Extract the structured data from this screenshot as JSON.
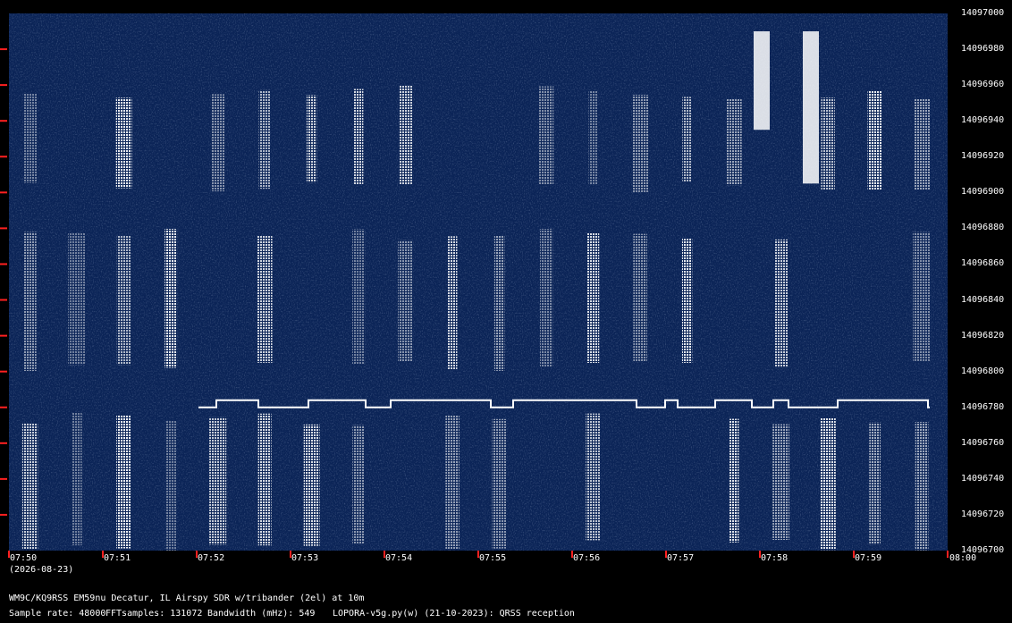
{
  "chart_data": {
    "type": "heatmap",
    "colors": {
      "background": "#0b2457",
      "signal": "#ffffff",
      "tick": "#ff2020",
      "text": "#ffffff"
    },
    "y_axis": {
      "min": 14096700,
      "max": 14097000,
      "ticks": [
        "14097000",
        "14096980",
        "14096960",
        "14096940",
        "14096920",
        "14096900",
        "14096880",
        "14096860",
        "14096840",
        "14096820",
        "14096800",
        "14096780",
        "14096760",
        "14096740",
        "14096720",
        "14096700"
      ]
    },
    "x_axis": {
      "ticks": [
        "07:50",
        "07:51",
        "07:52",
        "07:53",
        "07:54",
        "07:55",
        "07:56",
        "07:57",
        "07:58",
        "07:59",
        "08:00"
      ],
      "date_label": "(2026-08-23)"
    },
    "callsign_trace": {
      "name": "",
      "comment": "",
      "base_hz": 14096780,
      "high_hz": 14096784
    }
  },
  "footer": {
    "station": "WM9C/KQ9RSS EM59nu Decatur, IL  Airspy SDR w/tribander (2el) at 10m",
    "sample_rate": "Sample rate: 48000",
    "fft_samples": "FFTsamples: 131072",
    "bandwidth": "Bandwidth (mHz): 549",
    "software": "LOPORA-v5g.py(w) (21-10-2023): QRSS reception"
  }
}
